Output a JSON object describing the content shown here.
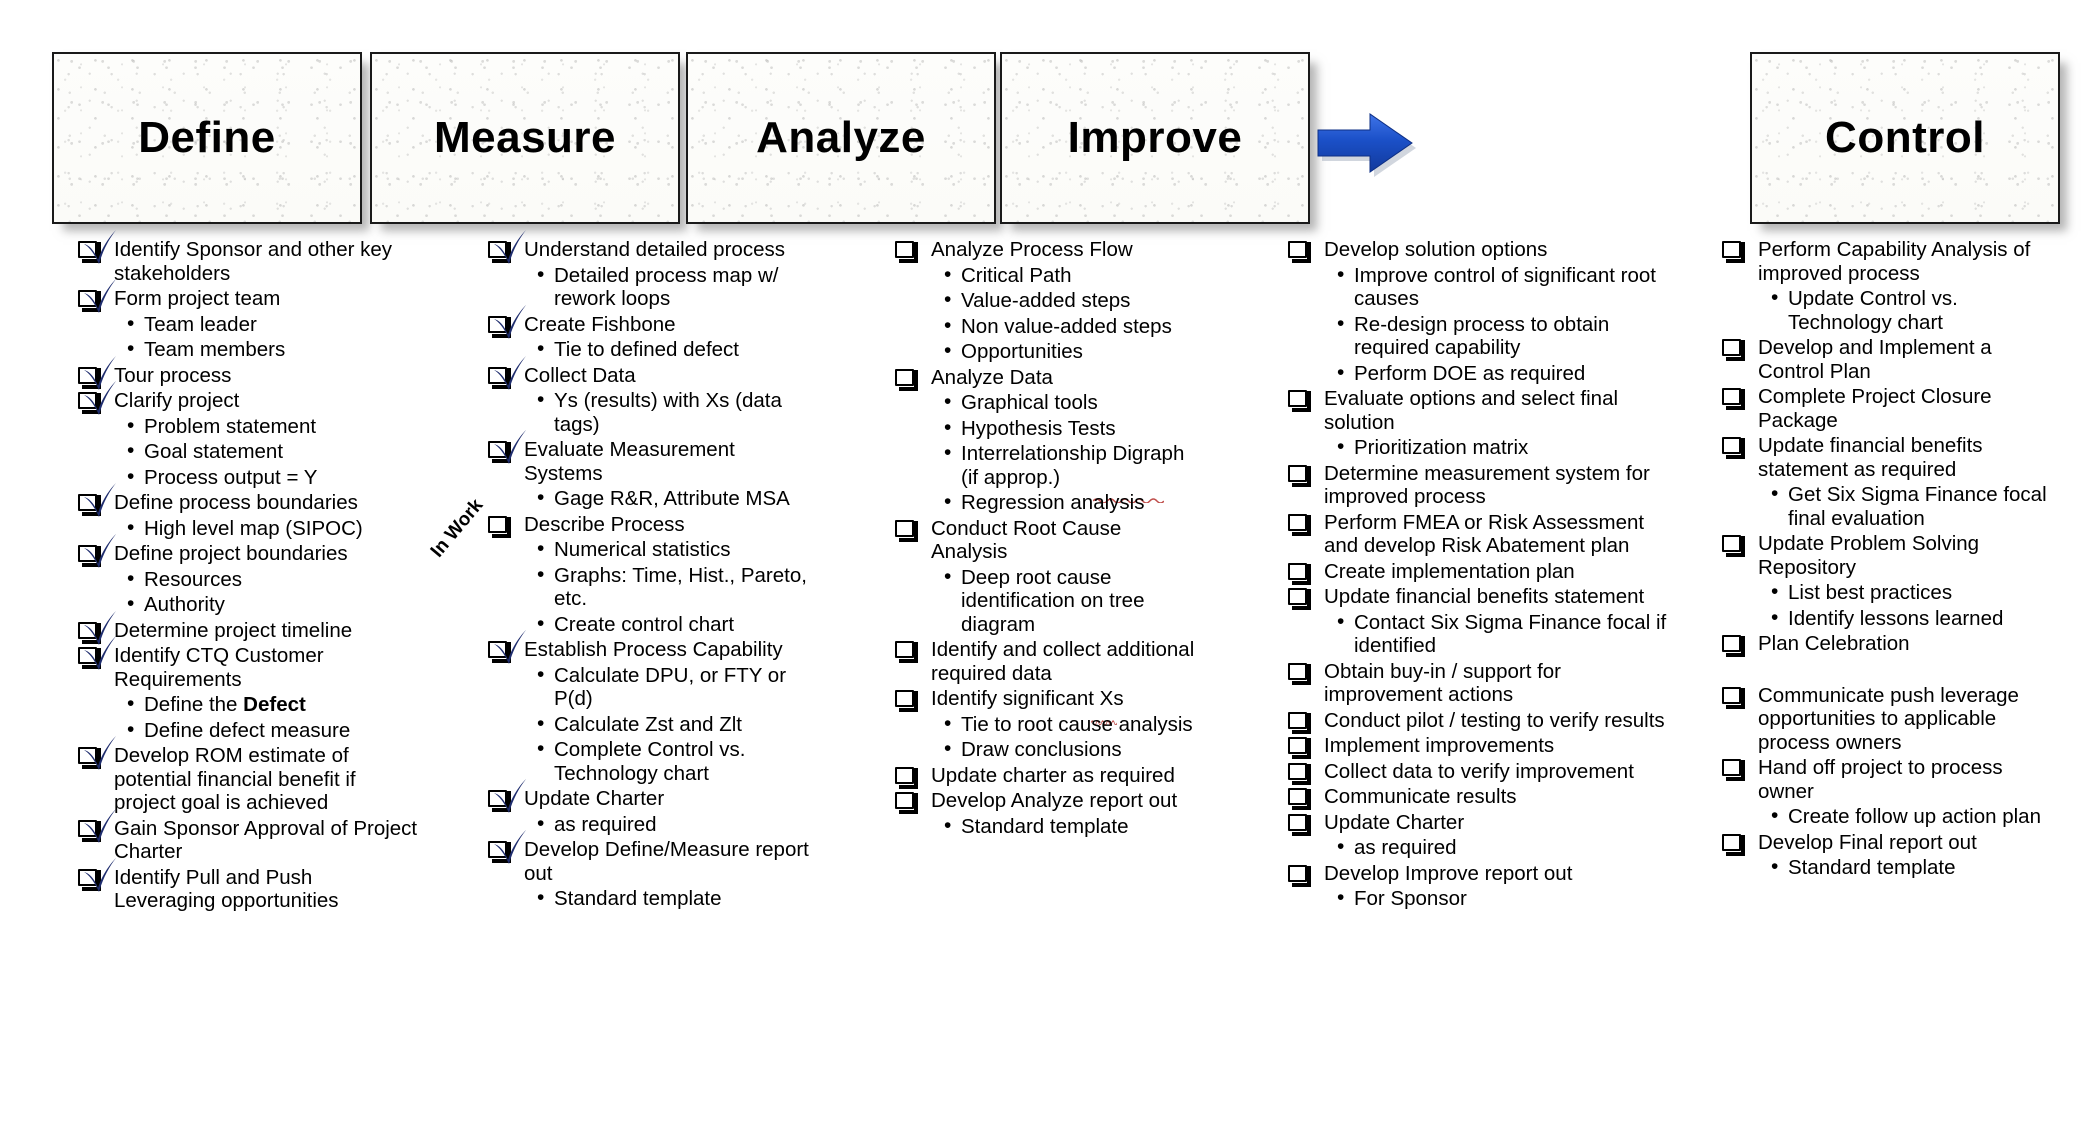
{
  "phases": [
    {
      "label": "Define",
      "arrow_after": true
    },
    {
      "label": "Measure",
      "arrow_after": true
    },
    {
      "label": "Analyze",
      "arrow_after": true
    },
    {
      "label": "Improve",
      "arrow_after": true
    },
    {
      "label": "Control",
      "arrow_after": false
    }
  ],
  "annotations": {
    "in_work": "In Work"
  },
  "columns": [
    {
      "phase": "Define",
      "items": [
        {
          "text": "Identify Sponsor and other key stakeholders",
          "checked": true
        },
        {
          "text": "Form project team",
          "checked": true
        },
        {
          "text": "Team leader",
          "sub": true
        },
        {
          "text": "Team members",
          "sub": true
        },
        {
          "text": "Tour process",
          "checked": true
        },
        {
          "text": "Clarify project",
          "checked": true
        },
        {
          "text": "Problem statement",
          "sub": true
        },
        {
          "text": "Goal statement",
          "sub": true
        },
        {
          "text": "Process output = Y",
          "sub": true
        },
        {
          "text": "Define process boundaries",
          "checked": true
        },
        {
          "text": "High level map (SIPOC)",
          "sub": true
        },
        {
          "text": "Define project boundaries",
          "checked": true
        },
        {
          "text": "Resources",
          "sub": true
        },
        {
          "text": "Authority",
          "sub": true
        },
        {
          "text": "Determine project timeline",
          "checked": true
        },
        {
          "text": "Identify CTQ Customer Requirements",
          "checked": true
        },
        {
          "text": "Define the Defect",
          "sub": true,
          "bold_tail": "Defect",
          "head": "Define the "
        },
        {
          "text": "Define defect measure",
          "sub": true
        },
        {
          "text": "Develop ROM estimate of potential financial benefit if project goal is achieved",
          "checked": true
        },
        {
          "text": "Gain Sponsor Approval of Project Charter",
          "checked": true
        },
        {
          "text": "Identify Pull and Push Leveraging opportunities",
          "checked": true
        }
      ]
    },
    {
      "phase": "Measure",
      "items": [
        {
          "text": "Understand detailed process",
          "checked": true
        },
        {
          "text": "Detailed process map w/ rework loops",
          "sub": true
        },
        {
          "text": "Create Fishbone",
          "checked": true
        },
        {
          "text": "Tie to defined defect",
          "sub": true
        },
        {
          "text": "Collect Data",
          "checked": true
        },
        {
          "text": "Ys (results)  with Xs (data tags)",
          "sub": true
        },
        {
          "text": "Evaluate Measurement Systems",
          "checked": true
        },
        {
          "text": "Gage R&R, Attribute MSA",
          "sub": true
        },
        {
          "text": "Describe Process",
          "checked": false,
          "in_work": true
        },
        {
          "text": "Numerical statistics",
          "sub": true
        },
        {
          "text": "Graphs: Time, Hist., Pareto, etc.",
          "sub": true
        },
        {
          "text": "Create control chart",
          "sub": true
        },
        {
          "text": "Establish Process Capability",
          "checked": true
        },
        {
          "text": "Calculate DPU, or FTY or P(d)",
          "sub": true
        },
        {
          "text": "Calculate Zst and Zlt",
          "sub": true
        },
        {
          "text": "Complete Control vs. Technology chart",
          "sub": true
        },
        {
          "text": "Update Charter",
          "checked": true
        },
        {
          "text": "as required",
          "sub": true
        },
        {
          "text": "Develop Define/Measure report out",
          "checked": true
        },
        {
          "text": "Standard template",
          "sub": true
        }
      ]
    },
    {
      "phase": "Analyze",
      "items": [
        {
          "text": "Analyze Process Flow",
          "checked": false
        },
        {
          "text": "Critical Path",
          "sub": true
        },
        {
          "text": "Value-added steps",
          "sub": true
        },
        {
          "text": "Non value-added steps",
          "sub": true
        },
        {
          "text": "Opportunities",
          "sub": true
        },
        {
          "text": "Analyze Data",
          "checked": false
        },
        {
          "text": "Graphical tools",
          "sub": true
        },
        {
          "text": "Hypothesis Tests",
          "sub": true
        },
        {
          "text": "Interrelationship Digraph (if approp.)",
          "sub": true,
          "squiggle": "approp."
        },
        {
          "text": "Regression analysis",
          "sub": true
        },
        {
          "text": "Conduct Root Cause Analysis",
          "checked": false
        },
        {
          "text": "Deep root cause identification on tree diagram",
          "sub": true
        },
        {
          "text": "Identify and collect additional required data",
          "checked": false
        },
        {
          "text": "Identify significant Xs",
          "checked": false,
          "squiggle": "Xs"
        },
        {
          "text": "Tie to root cause analysis",
          "sub": true
        },
        {
          "text": "Draw conclusions",
          "sub": true
        },
        {
          "text": "Update charter as required",
          "checked": false
        },
        {
          "text": "Develop Analyze report out",
          "checked": false
        },
        {
          "text": "Standard template",
          "sub": true
        }
      ]
    },
    {
      "phase": "Improve",
      "items": [
        {
          "text": "Develop solution options",
          "checked": false
        },
        {
          "text": "Improve control of significant root causes",
          "sub": true
        },
        {
          "text": "Re-design process to obtain required capability",
          "sub": true
        },
        {
          "text": "Perform DOE as required",
          "sub": true
        },
        {
          "text": "Evaluate options and select final solution",
          "checked": false
        },
        {
          "text": "Prioritization matrix",
          "sub": true
        },
        {
          "text": "Determine measurement system for improved process",
          "checked": false
        },
        {
          "text": "Perform FMEA or Risk Assessment and develop Risk Abatement plan",
          "checked": false
        },
        {
          "text": "Create implementation plan",
          "checked": false
        },
        {
          "text": "Update financial benefits statement",
          "checked": false
        },
        {
          "text": "Contact Six Sigma Finance focal if identified",
          "sub": true
        },
        {
          "text": "Obtain buy-in / support for improvement actions",
          "checked": false
        },
        {
          "text": "Conduct pilot / testing to verify results",
          "checked": false
        },
        {
          "text": "Implement improvements",
          "checked": false
        },
        {
          "text": "Collect data to verify improvement",
          "checked": false
        },
        {
          "text": "Communicate results",
          "checked": false
        },
        {
          "text": "Update Charter",
          "checked": false
        },
        {
          "text": "as required",
          "sub": true
        },
        {
          "text": "Develop Improve report out",
          "checked": false
        },
        {
          "text": "For Sponsor",
          "sub": true
        }
      ]
    },
    {
      "phase": "Control",
      "items": [
        {
          "text": "Perform  Capability Analysis of improved process",
          "checked": false
        },
        {
          "text": "Update Control vs. Technology chart",
          "sub": true
        },
        {
          "text": "Develop and Implement a Control Plan",
          "checked": false
        },
        {
          "text": "Complete Project Closure Package",
          "checked": false
        },
        {
          "text": "Update financial benefits statement as required",
          "checked": false
        },
        {
          "text": "Get Six Sigma Finance focal final evaluation",
          "sub": true
        },
        {
          "text": "Update Problem Solving Repository",
          "checked": false
        },
        {
          "text": "List best practices",
          "sub": true
        },
        {
          "text": "Identify lessons learned",
          "sub": true
        },
        {
          "text": "Plan Celebration",
          "checked": false
        },
        {
          "text": "Communicate push leverage opportunities to applicable process owners",
          "checked": false,
          "gap_before": true
        },
        {
          "text": "Hand off project to process owner",
          "checked": false
        },
        {
          "text": "Create follow up action plan",
          "sub": true
        },
        {
          "text": "Develop Final report out",
          "checked": false
        },
        {
          "text": "Standard template",
          "sub": true
        }
      ]
    }
  ],
  "colors": {
    "arrow_fill": "#1b50c8",
    "arrow_fill_light": "#3f74e8",
    "check_blue": "#1f2d6e",
    "box_border": "#1a1a1a",
    "text": "#000000",
    "squiggle": "#c0504d"
  }
}
